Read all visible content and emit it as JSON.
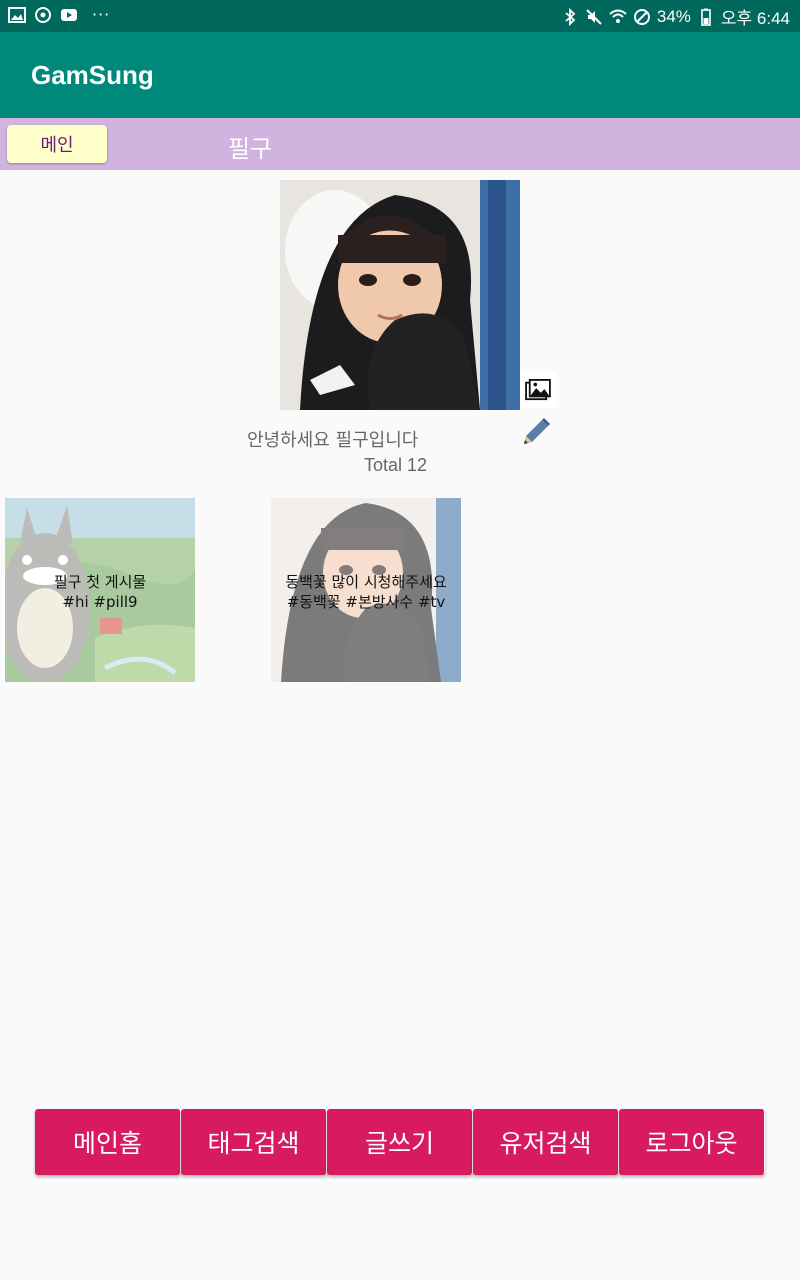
{
  "status_bar": {
    "left_icons": [
      "image-icon",
      "sync-icon",
      "youtube-icon"
    ],
    "more": "···",
    "battery": "34%",
    "time": "오후 6:44"
  },
  "app_bar": {
    "title": "GamSung"
  },
  "sub_header": {
    "main_button": "메인",
    "title": "필구"
  },
  "profile": {
    "greeting": "안녕하세요 필구입니다",
    "total": "Total 12"
  },
  "posts": [
    {
      "line1": "필구 첫 게시물",
      "line2": "#hi #pill9"
    },
    {
      "line1": "동백꽃 많이 시청해주세요",
      "line2": "#동백꽃 #본방사수 #tv"
    }
  ],
  "bottom_nav": [
    "메인홈",
    "태그검색",
    "글쓰기",
    "유저검색",
    "로그아웃"
  ],
  "colors": {
    "status_bar": "#00695c",
    "app_bar": "#00897b",
    "sub_header": "#d1b3df",
    "main_button": "#ffffcc",
    "nav_button": "#d81b60"
  }
}
